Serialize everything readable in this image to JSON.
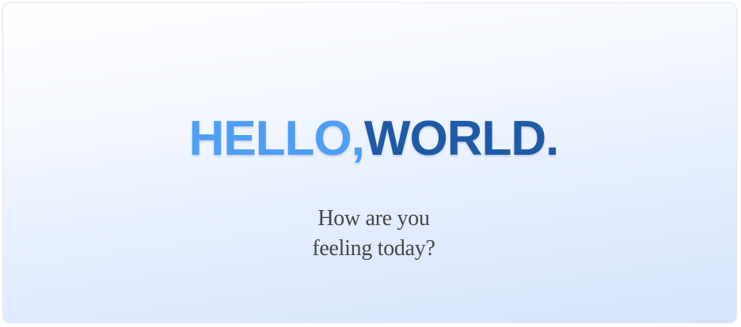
{
  "headline": {
    "hello": "HELLO,",
    "world": "WORLD."
  },
  "question": {
    "line1": "How are you",
    "line2": "feeling today?"
  },
  "colors": {
    "hello": "#4f9ef5",
    "world": "#1f5aa6",
    "question_text": "#464646",
    "gradient_top": "#ffffff",
    "gradient_bottom": "#d3e3fc"
  }
}
